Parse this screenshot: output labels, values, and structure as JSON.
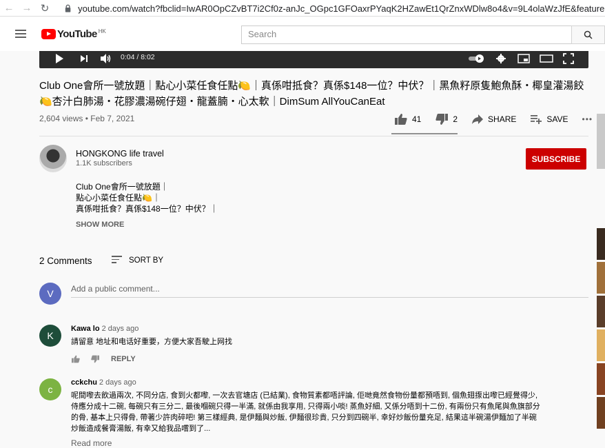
{
  "browser": {
    "url": "youtube.com/watch?fbclid=IwAR0OpCZvBT7i2Cf0z-anJc_OGpc1GFOaxrPYaqK2HZawEt1QrZnxWDlw8o4&v=9L4olaWzJfE&feature=youtu.b"
  },
  "header": {
    "logo_text": "YouTube",
    "region": "HK",
    "search_placeholder": "Search"
  },
  "player": {
    "time": "0:04 / 8:02"
  },
  "video": {
    "title": "Club One會所一號放題｜點心小菜任食任點🍋｜真係咁抵食？真係$148一位？中伏？｜黑魚籽原隻鮑魚酥・椰皇灌湯餃🍋杏汁白肺湯・花膠濃湯碗仔翅・龍蓋腩・心太軟｜DimSum AllYouCanEat",
    "views": "2,604 views • Feb 7, 2021",
    "likes": "41",
    "dislikes": "2",
    "share": "SHARE",
    "save": "SAVE",
    "more": "•••"
  },
  "channel": {
    "name": "HONGKONG life travel",
    "subscribers": "1.1K subscribers",
    "subscribe_label": "SUBSCRIBE"
  },
  "description": {
    "lines": [
      "Club One會所一號放題｜",
      "點心小菜任食任點🍋｜",
      "真係咁抵食？真係$148一位？中伏？｜"
    ],
    "show_more": "SHOW MORE"
  },
  "comments": {
    "count_label": "2 Comments",
    "sort_label": "SORT BY",
    "add_placeholder": "Add a public comment...",
    "current_user_initial": "V",
    "items": [
      {
        "initial": "K",
        "avatar_color": "#1e4d3a",
        "author": "Kawa lo",
        "time": "2 days ago",
        "text": "請留意 地址和电话好重要，方便大家吾駛上网找",
        "reply": "REPLY"
      },
      {
        "initial": "c",
        "avatar_color": "#7cb342",
        "author": "cckchu",
        "time": "2 days ago",
        "text_lines": [
          "呢間嚟去飲過兩次, 不同分店, 食到火都嚟, 一次去官塘店 (已結業), 食物質素都唔評論, 佢哋竟然食物份量都預唔到, 個魚翅揼出嚟已經覺得少,",
          "侍應分成十二碗, 每碗只有三分二, 最後嗰碗只得一半滿, 就係由我享用, 只得兩小啖! 蒸魚好細, 又係分唔到十二份, 有兩份只有魚尾與魚旗部分",
          "的骨, 基本上只得骨, 帶著少許肉碎吧! 第三樣經典, 是伊麵與炒飯, 伊麵很珍貴, 只分到四碗半, 幸好炒飯份量充足, 結果這半碗湯伊麵加了半碗",
          "炒飯造成餐膏湯飯, 有幸又給我品嚐到了..."
        ],
        "read_more": "Read more"
      }
    ]
  },
  "colors": {
    "subscribe": "#cc0000",
    "current_user_avatar": "#5c6bc0"
  }
}
